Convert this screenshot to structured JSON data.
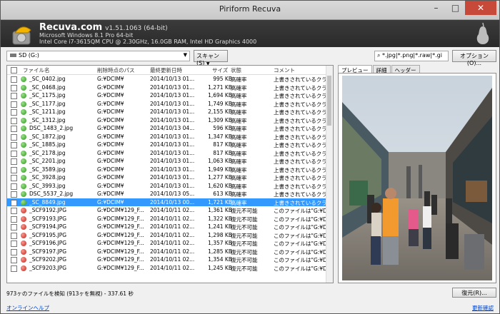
{
  "window": {
    "title": "Piriform Recuva",
    "min": "–",
    "max": "□",
    "close": "✕"
  },
  "header": {
    "app_name": "Recuva.com",
    "version": "v1.51.1063 (64-bit)",
    "os_line": "Microsoft Windows 8.1 Pro 64-bit",
    "hw_line": "Intel Core i7-3615QM CPU @ 2.30GHz, 16.0GB RAM, Intel HD Graphics 4000"
  },
  "toolbar": {
    "drive": "SD (G:)",
    "scan_label": "スキャン(S)",
    "filter_value": "*.jpg|*.png|*.raw|*.gi",
    "options_label": "オプション(O)..."
  },
  "columns": {
    "filename": "ファイル名",
    "path": "削除時点のパス",
    "modified": "最終更新日時",
    "size": "サイズ",
    "state": "状態",
    "comment": "コメント"
  },
  "rows": [
    {
      "name": "_SC_0402.jpg",
      "path": "G:¥DCIM¥",
      "date": "2014/10/13 01...",
      "size": "995 KB",
      "state": "高確率",
      "comment": "上書きされているクラスタは",
      "status": "green"
    },
    {
      "name": "_SC_0468.jpg",
      "path": "G:¥DCIM¥",
      "date": "2014/10/13 01...",
      "size": "1,271 KB",
      "state": "高確率",
      "comment": "上書きされているクラスタは",
      "status": "green"
    },
    {
      "name": "_SC_1175.jpg",
      "path": "G:¥DCIM¥",
      "date": "2014/10/13 01...",
      "size": "1,694 KB",
      "state": "高確率",
      "comment": "上書きされているクラスタは",
      "status": "green"
    },
    {
      "name": "_SC_1177.jpg",
      "path": "G:¥DCIM¥",
      "date": "2014/10/13 01...",
      "size": "1,749 KB",
      "state": "高確率",
      "comment": "上書きされているクラスタは",
      "status": "green"
    },
    {
      "name": "_SC_1211.jpg",
      "path": "G:¥DCIM¥",
      "date": "2014/10/13 01...",
      "size": "2,155 KB",
      "state": "高確率",
      "comment": "上書きされているクラスタは",
      "status": "green"
    },
    {
      "name": "_SC_1312.jpg",
      "path": "G:¥DCIM¥",
      "date": "2014/10/13 01...",
      "size": "1,309 KB",
      "state": "高確率",
      "comment": "上書きされているクラスタは",
      "status": "green"
    },
    {
      "name": "DSC_1483_2.jpg",
      "path": "G:¥DCIM¥",
      "date": "2014/10/13 04...",
      "size": "596 KB",
      "state": "高確率",
      "comment": "上書きされているクラスタは",
      "status": "green"
    },
    {
      "name": "_SC_1872.jpg",
      "path": "G:¥DCIM¥",
      "date": "2014/10/13 01...",
      "size": "1,347 KB",
      "state": "高確率",
      "comment": "上書きされているクラスタは",
      "status": "green"
    },
    {
      "name": "_SC_1885.jpg",
      "path": "G:¥DCIM¥",
      "date": "2014/10/13 01...",
      "size": "817 KB",
      "state": "高確率",
      "comment": "上書きされているクラスタは",
      "status": "green"
    },
    {
      "name": "_SC_2178.jpg",
      "path": "G:¥DCIM¥",
      "date": "2014/10/13 01...",
      "size": "817 KB",
      "state": "高確率",
      "comment": "上書きされているクラスタは",
      "status": "green"
    },
    {
      "name": "_SC_2201.jpg",
      "path": "G:¥DCIM¥",
      "date": "2014/10/13 01...",
      "size": "1,063 KB",
      "state": "高確率",
      "comment": "上書きされているクラスタは",
      "status": "green"
    },
    {
      "name": "_SC_3589.jpg",
      "path": "G:¥DCIM¥",
      "date": "2014/10/13 01...",
      "size": "1,949 KB",
      "state": "高確率",
      "comment": "上書きされているクラスタは",
      "status": "green"
    },
    {
      "name": "_SC_3928.jpg",
      "path": "G:¥DCIM¥",
      "date": "2014/10/13 01...",
      "size": "1,277 KB",
      "state": "高確率",
      "comment": "上書きされているクラスタは",
      "status": "green"
    },
    {
      "name": "_SC_3993.jpg",
      "path": "G:¥DCIM¥",
      "date": "2014/10/13 01...",
      "size": "1,620 KB",
      "state": "高確率",
      "comment": "上書きされているクラスタは",
      "status": "green"
    },
    {
      "name": "DSC_5537_2.jpg",
      "path": "G:¥DCIM¥",
      "date": "2014/10/13 05...",
      "size": "613 KB",
      "state": "高確率",
      "comment": "上書きされているクラスタは",
      "status": "green"
    },
    {
      "name": "_SC_8849.jpg",
      "path": "G:¥DCIM¥",
      "date": "2014/10/13 00...",
      "size": "1,721 KB",
      "state": "高確率",
      "comment": "上書きされているクラスタは",
      "status": "green",
      "selected": true
    },
    {
      "name": "_SCF9192.JPG",
      "path": "G:¥DCIM¥129_F...",
      "date": "2014/10/11 02...",
      "size": "1,361 KB",
      "state": "復元不可能",
      "comment": "このファイルは\"G:¥DCIM¥",
      "status": "red"
    },
    {
      "name": "_SCF9193.JPG",
      "path": "G:¥DCIM¥129_F...",
      "date": "2014/10/11 02...",
      "size": "1,322 KB",
      "state": "復元不可能",
      "comment": "このファイルは\"G:¥DCIM¥",
      "status": "red"
    },
    {
      "name": "_SCF9194.JPG",
      "path": "G:¥DCIM¥129_F...",
      "date": "2014/10/11 02...",
      "size": "1,241 KB",
      "state": "復元不可能",
      "comment": "このファイルは\"G:¥DCIM¥",
      "status": "red"
    },
    {
      "name": "_SCF9195.JPG",
      "path": "G:¥DCIM¥129_F...",
      "date": "2014/10/11 02...",
      "size": "1,298 KB",
      "state": "復元不可能",
      "comment": "このファイルは\"G:¥DCIM¥",
      "status": "red"
    },
    {
      "name": "_SCF9196.JPG",
      "path": "G:¥DCIM¥129_F...",
      "date": "2014/10/11 02...",
      "size": "1,357 KB",
      "state": "復元不可能",
      "comment": "このファイルは\"G:¥DCIM¥",
      "status": "red"
    },
    {
      "name": "_SCF9197.JPG",
      "path": "G:¥DCIM¥129_F...",
      "date": "2014/10/11 02...",
      "size": "1,285 KB",
      "state": "復元不可能",
      "comment": "このファイルは\"G:¥DCIM¥",
      "status": "red"
    },
    {
      "name": "_SCF9202.JPG",
      "path": "G:¥DCIM¥129_F...",
      "date": "2014/10/11 02...",
      "size": "1,354 KB",
      "state": "復元不可能",
      "comment": "このファイルは\"G:¥DCIM¥",
      "status": "red"
    },
    {
      "name": "_SCF9203.JPG",
      "path": "G:¥DCIM¥129_F...",
      "date": "2014/10/11 02...",
      "size": "1,245 KB",
      "state": "復元不可能",
      "comment": "このファイルは\"G:¥DCIM¥",
      "status": "red"
    }
  ],
  "tabs": [
    "プレビュー",
    "詳細",
    "ヘッダー"
  ],
  "status_text": "973ヶのファイルを検知 (913ヶを無視) - 337.61 秒",
  "recover_label": "復元(R)...",
  "links": {
    "help": "オンラインヘルプ",
    "update": "更新確認"
  },
  "colors": {
    "selected": "#3399ff",
    "green": "#2d9a1c",
    "red": "#c8231b",
    "link": "#0044cc"
  }
}
